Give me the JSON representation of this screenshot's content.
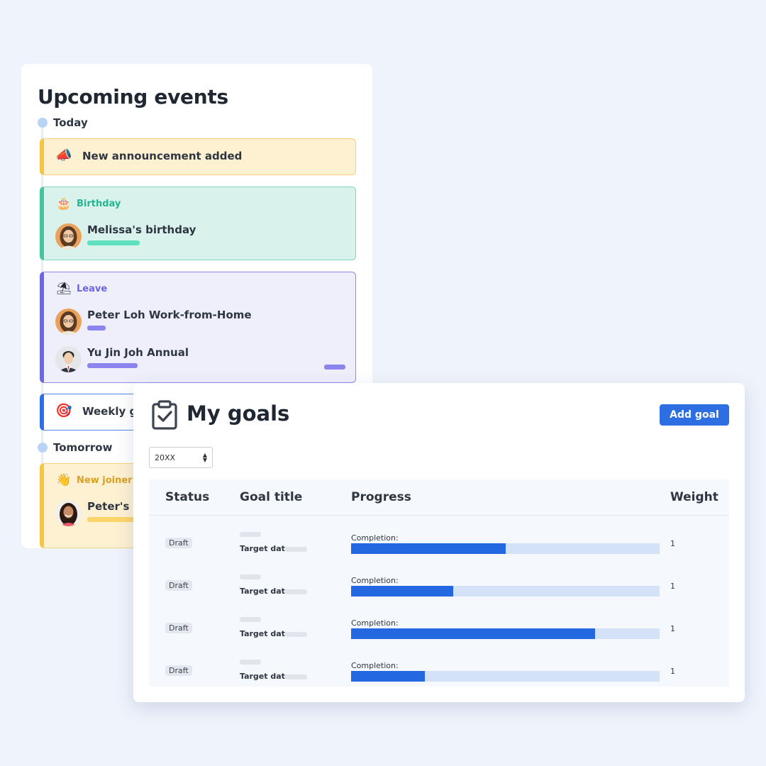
{
  "events": {
    "title": "Upcoming events",
    "today_label": "Today",
    "tomorrow_label": "Tomorrow",
    "announcement": {
      "icon": "megaphone-icon",
      "text": "New announcement added"
    },
    "birthday": {
      "icon": "cake-icon",
      "category": "Birthday",
      "category_color": "#24b591",
      "people": [
        {
          "name": "Melissa's birthday"
        }
      ]
    },
    "leave": {
      "icon": "beach-umbrella-icon",
      "category": "Leave",
      "category_color": "#6d66e0",
      "people": [
        {
          "name": "Peter Loh Work-from-Home"
        },
        {
          "name": "Yu Jin Joh Annual"
        }
      ]
    },
    "weekly": {
      "icon": "target-icon",
      "text": "Weekly go"
    },
    "new_joiner": {
      "icon": "waving-hand-icon",
      "category": "New joiner",
      "category_color": "#d9a020",
      "people": [
        {
          "name": "Peter's fi"
        }
      ]
    }
  },
  "goals": {
    "title": "My goals",
    "icon": "clipboard-check-icon",
    "add_button": "Add goal",
    "year_select": {
      "value": "20XX"
    },
    "columns": [
      "Status",
      "Goal title",
      "Progress",
      "Weight"
    ],
    "rows": [
      {
        "status": "Draft",
        "target_label": "Target date:",
        "completion_label": "Completion:",
        "progress": 0.5,
        "weight": "1"
      },
      {
        "status": "Draft",
        "target_label": "Target date:",
        "completion_label": "Completion:",
        "progress": 0.33,
        "weight": "1"
      },
      {
        "status": "Draft",
        "target_label": "Target date:",
        "completion_label": "Completion:",
        "progress": 0.79,
        "weight": "1"
      },
      {
        "status": "Draft",
        "target_label": "Target date:",
        "completion_label": "Completion:",
        "progress": 0.24,
        "weight": "1"
      }
    ],
    "accent_color": "#2468e1"
  }
}
